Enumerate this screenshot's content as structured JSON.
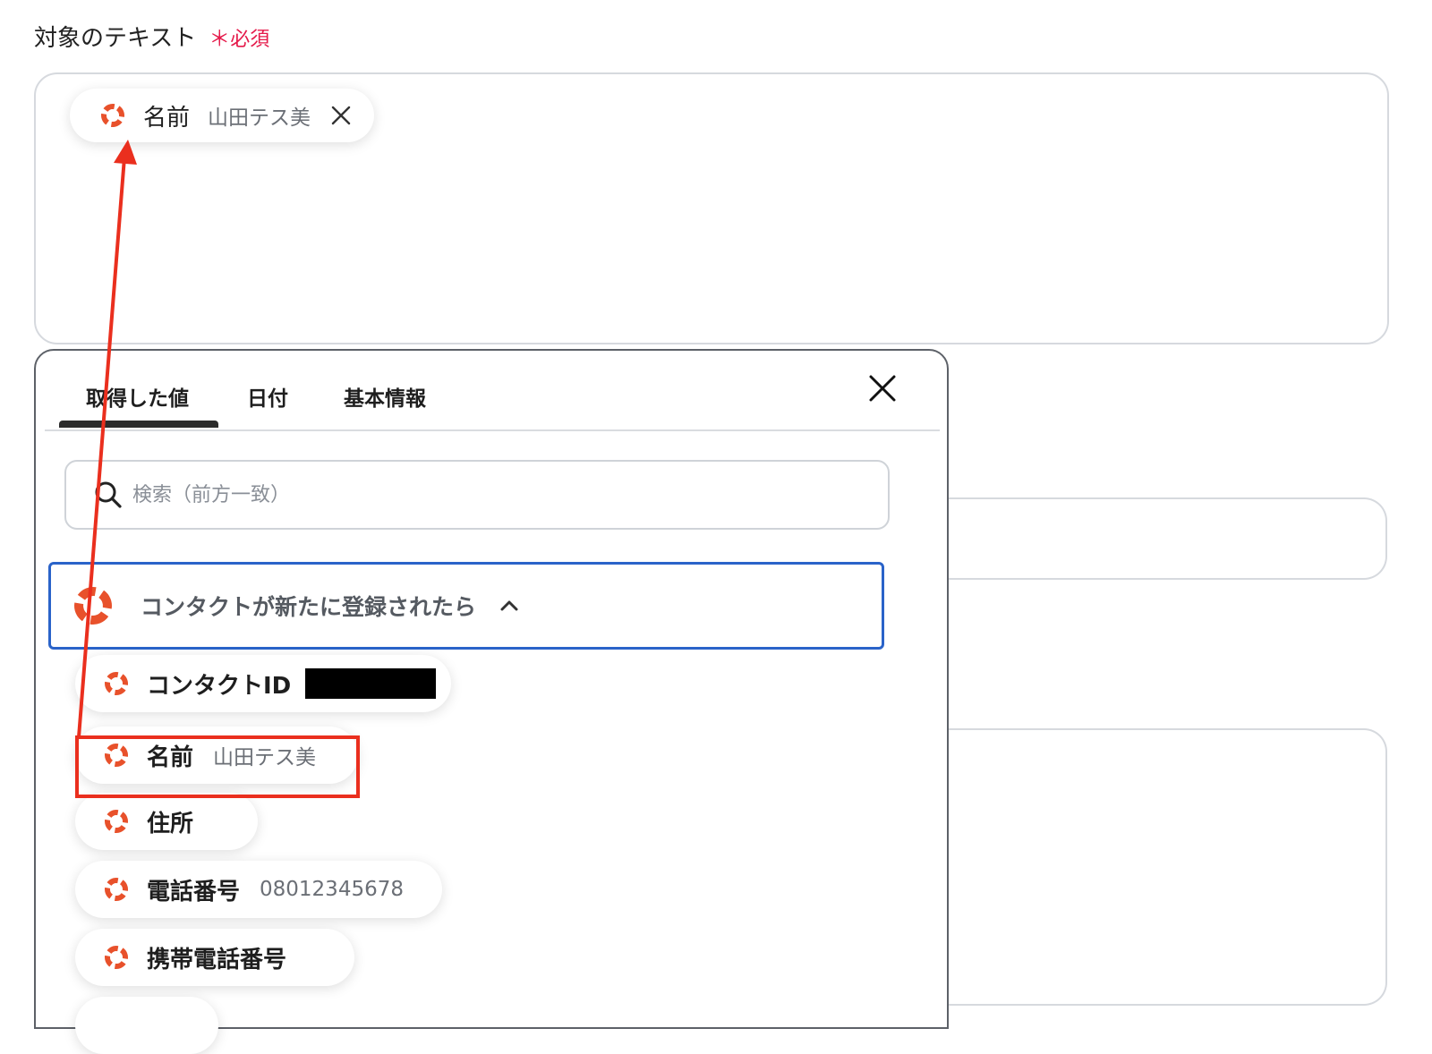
{
  "field": {
    "label": "対象のテキスト",
    "required_mark": "＊",
    "required_text": "必須"
  },
  "selected_chip": {
    "name": "名前",
    "value": "山田テス美",
    "icon": "lifebuoy-icon"
  },
  "popup": {
    "tabs": [
      {
        "label": "取得した値",
        "active": true
      },
      {
        "label": "日付",
        "active": false
      },
      {
        "label": "基本情報",
        "active": false
      }
    ],
    "search_placeholder": "検索（前方一致）",
    "group": {
      "label": "コンタクトが新たに登録されたら",
      "expanded": true,
      "icon": "lifebuoy-icon"
    },
    "items": [
      {
        "name": "コンタクトID",
        "value": "",
        "redacted": true
      },
      {
        "name": "名前",
        "value": "山田テス美"
      },
      {
        "name": "住所",
        "value": ""
      },
      {
        "name": "電話番号",
        "value": "08012345678"
      },
      {
        "name": "携帯電話番号",
        "value": ""
      }
    ]
  },
  "colors": {
    "required": "#e5194a",
    "active_group_border": "#2a63c9",
    "annotation": "#ea2f1e",
    "icon": "#e8512b"
  }
}
